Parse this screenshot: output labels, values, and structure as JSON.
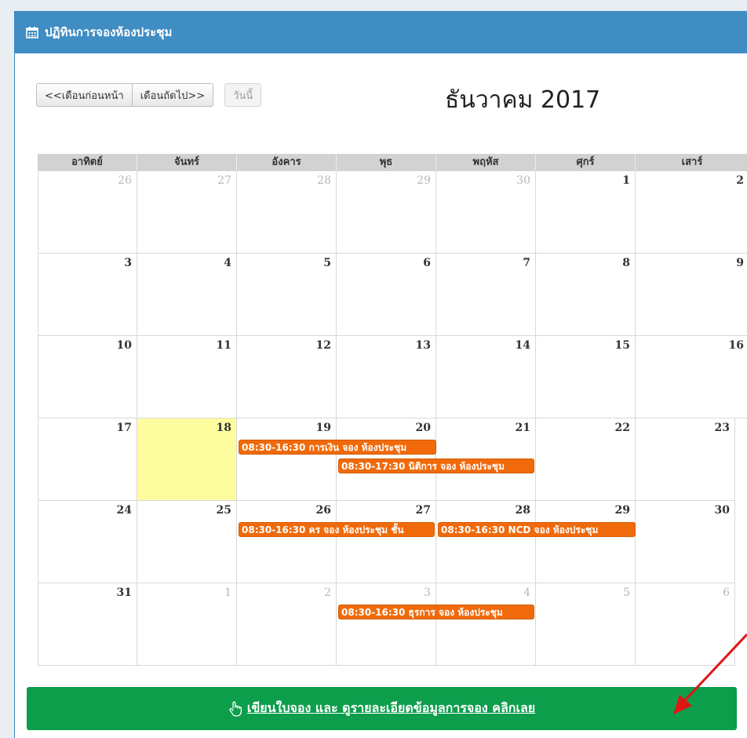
{
  "panel": {
    "title": "ปฏิทินการจองห้องประชุม"
  },
  "toolbar": {
    "prev_label": "<<เดือนก่อนหน้า",
    "next_label": "เดือนถัดไป>>",
    "today_label": "วันนี้"
  },
  "calendar": {
    "month_title": "ธันวาคม 2017",
    "weekdays": [
      "อาทิตย์",
      "จันทร์",
      "อังคาร",
      "พุธ",
      "พฤหัส",
      "ศุกร์",
      "เสาร์"
    ],
    "weeks": [
      [
        "26",
        "27",
        "28",
        "29",
        "30",
        "1",
        "2"
      ],
      [
        "3",
        "4",
        "5",
        "6",
        "7",
        "8",
        "9"
      ],
      [
        "10",
        "11",
        "12",
        "13",
        "14",
        "15",
        "16"
      ],
      [
        "17",
        "18",
        "19",
        "20",
        "21",
        "22",
        "23"
      ],
      [
        "24",
        "25",
        "26",
        "27",
        "28",
        "29",
        "30"
      ],
      [
        "31",
        "1",
        "2",
        "3",
        "4",
        "5",
        "6"
      ]
    ],
    "today": "18",
    "events": [
      "08:30-16:30 การเงิน จอง ห้องประชุม",
      "08:30-17:30 นิติการ จอง ห้องประชุม",
      "08:30-16:30 คร จอง ห้องประชุม ชั้น",
      "08:30-16:30 NCD จอง ห้องประชุม",
      "08:30-16:30 ธุรการ จอง ห้องประชุม"
    ]
  },
  "cta": {
    "label": "เขียนใบจอง และ ดูรายละเอียดข้อมูลการจอง คลิกเลย"
  },
  "colors": {
    "header": "#3f8dc3",
    "event": "#f06a0b",
    "today": "#fdfd9f",
    "cta": "#0d9e4c",
    "arrow": "#e01616"
  }
}
